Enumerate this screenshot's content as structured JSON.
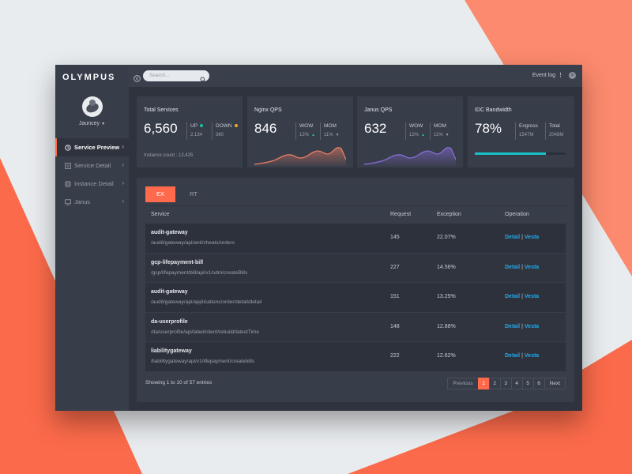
{
  "app": {
    "logo": "OLYMPUS",
    "user": "Jauncey"
  },
  "topbar": {
    "search_placeholder": "Search...",
    "event_log": "Event log"
  },
  "nav": {
    "items": [
      {
        "label": "Service Preview",
        "active": true
      },
      {
        "label": "Service Detail"
      },
      {
        "label": "Instance Detail"
      },
      {
        "label": "Janus"
      }
    ]
  },
  "cards": {
    "total": {
      "title": "Total Services",
      "value": "6,560",
      "up_label": "UP",
      "up_value": "2,134",
      "down_label": "DOWN",
      "down_value": "360",
      "instance_label": "Instance count :",
      "instance_value": "12,425"
    },
    "nginx": {
      "title": "Nginx QPS",
      "value": "846",
      "wow_label": "WOW",
      "wow_value": "12%",
      "mom_label": "MOM",
      "mom_value": "11%"
    },
    "janus": {
      "title": "Janus QPS",
      "value": "632",
      "wow_label": "WOW",
      "wow_value": "12%",
      "mom_label": "MOM",
      "mom_value": "11%"
    },
    "idc": {
      "title": "IDC Bandwidth",
      "value": "78%",
      "engross_label": "Engross",
      "engross_value": "1547M",
      "total_label": "Total",
      "total_value": "2048M",
      "usage_fraction": 0.78
    }
  },
  "tabs": [
    "EX",
    "RT"
  ],
  "table": {
    "headers": {
      "service": "Service",
      "request": "Request",
      "exception": "Exception",
      "operation": "Operation"
    },
    "rows": [
      {
        "service": "audit-gateway",
        "path": "/audit/gateway/api/anti/cheats/orders",
        "request": "145",
        "exception": "22.07%"
      },
      {
        "service": "gcp-lifepayment-bill",
        "path": "/gcp/lifepayment/bill/api/v1/sdm/createBills",
        "request": "227",
        "exception": "14.56%"
      },
      {
        "service": "audit-gateway",
        "path": "/audit/gateway/api/applications/order/detail/detail",
        "request": "151",
        "exception": "13.25%"
      },
      {
        "service": "da-userprofile",
        "path": "/da/userprofile/api/label/client/rebuild/latestTime",
        "request": "148",
        "exception": "12.88%"
      },
      {
        "service": "liabilitygateway",
        "path": "/liabilitygateway/api/v1/lifepayment/createbills",
        "request": "222",
        "exception": "12.62%"
      }
    ],
    "op_detail": "Detail",
    "op_vesta": "Vesta",
    "op_sep": "|"
  },
  "pagination": {
    "summary": "Showing 1 to 10 of 57 entries",
    "prev": "Previous",
    "pages": [
      "1",
      "2",
      "3",
      "4",
      "5",
      "6"
    ],
    "next": "Next",
    "current": "1"
  },
  "colors": {
    "accent": "#ff6a4d",
    "link": "#23a8ea",
    "up": "#19c0a0",
    "down": "#f5a623",
    "bandwidth": "#19c0c7",
    "nginx_line": "#f08066",
    "janus_line": "#8a6fdc"
  }
}
